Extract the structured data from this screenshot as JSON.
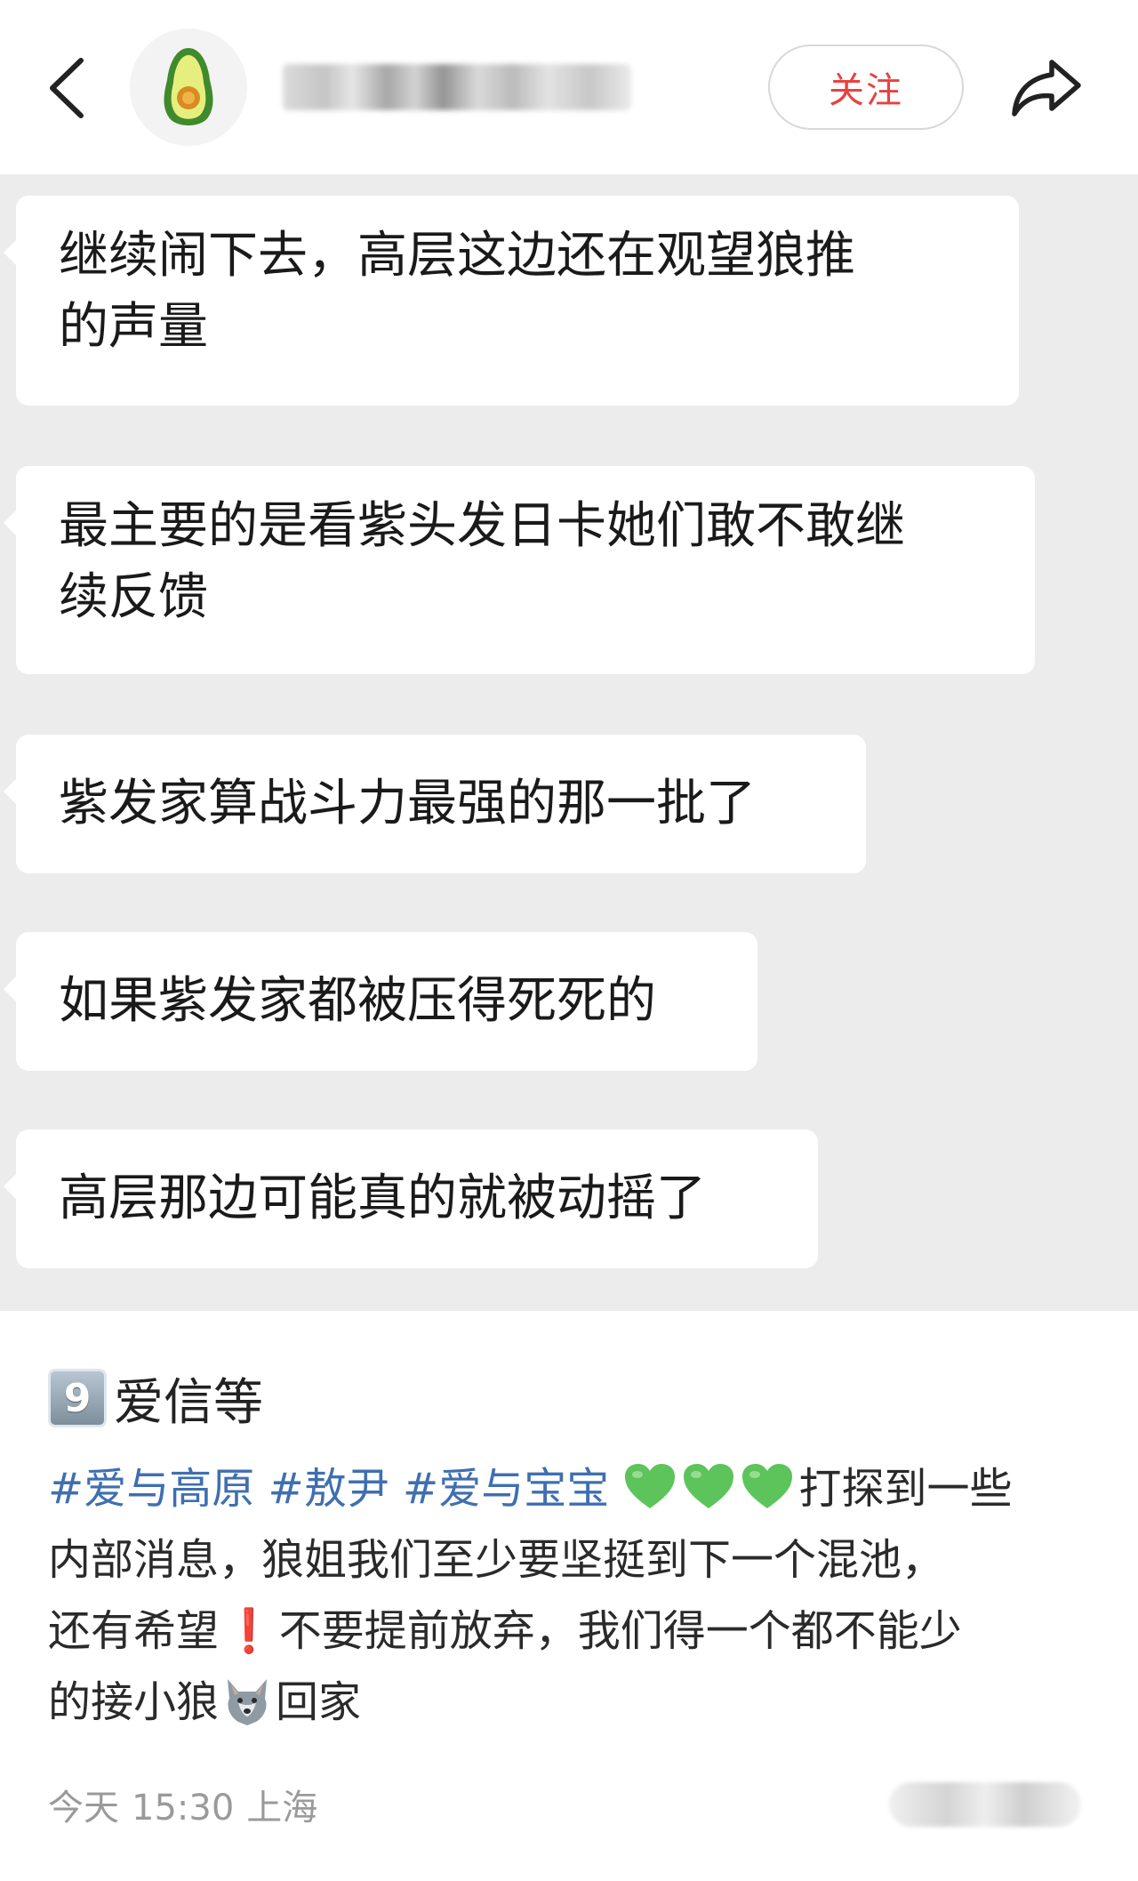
{
  "header": {
    "back_icon": "chevron-left-icon",
    "avatar_icon": "avocado-icon",
    "follow_label": "关注",
    "share_icon": "share-arrow-icon"
  },
  "chat": {
    "bubbles": [
      {
        "lines": [
          "继续闹下去，高层这边还在观望狼推",
          "的声量"
        ]
      },
      {
        "lines": [
          "最主要的是看紫头发日卡她们敢不敢继",
          "续反馈"
        ]
      },
      {
        "lines": [
          "紫发家算战斗力最强的那一批了"
        ]
      },
      {
        "lines": [
          "如果紫发家都被压得死死的"
        ]
      },
      {
        "lines": [
          "高层那边可能真的就被动摇了"
        ]
      }
    ]
  },
  "post": {
    "title_keycap": "9",
    "title_text": "爱信等",
    "tags": [
      "#爱与高原",
      "#敖尹",
      "#爱与宝宝"
    ],
    "body_line1_tail": "打探到一些",
    "body_line2": "内部消息，狼姐我们至少要坚挺到下一个混池，",
    "body_line3_a": "还有希望",
    "body_line3_excl": "❗",
    "body_line3_b": "不要提前放弃，我们得一个都不能少",
    "body_line4_a": "的接小狼",
    "body_line4_b": "回家",
    "emoji_heart": "green-heart-icon",
    "emoji_wolf": "wolf-icon",
    "colors": {
      "tag": "#3f6fb0",
      "heart": "#5cc45a",
      "follow": "#e8423f"
    }
  },
  "footer": {
    "day": "今天",
    "time": "15:30",
    "location": "上海"
  }
}
